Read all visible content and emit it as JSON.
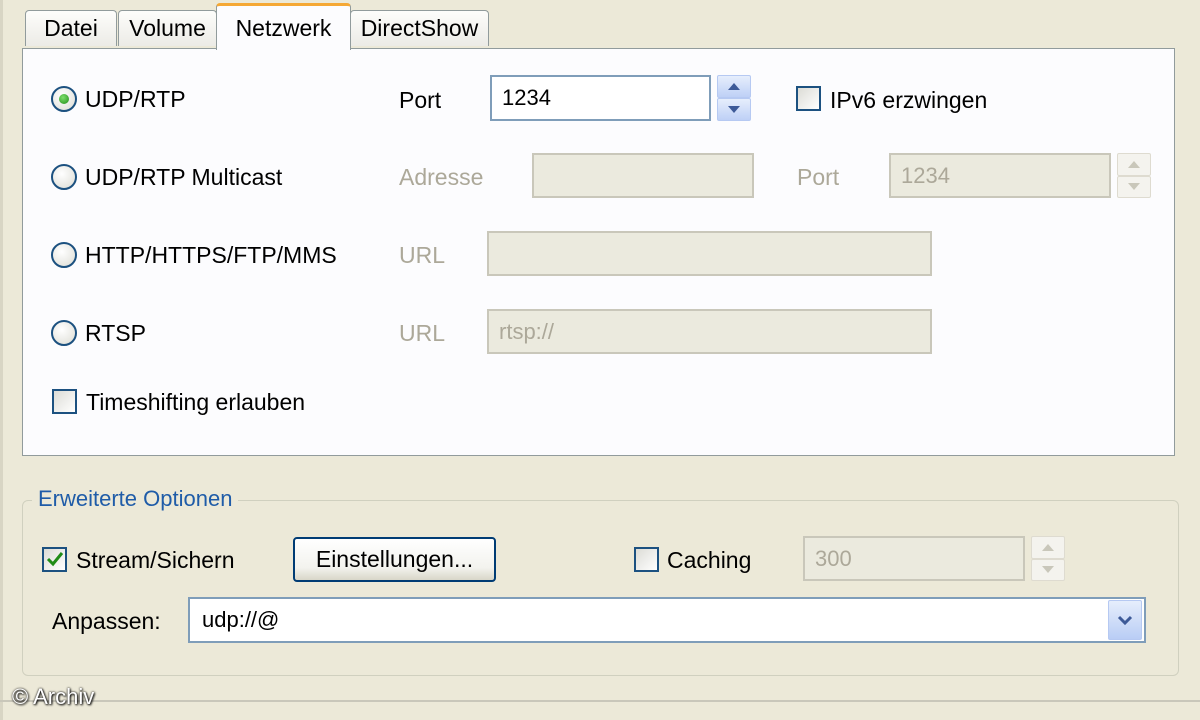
{
  "tabs": [
    {
      "label": "Datei"
    },
    {
      "label": "Volume"
    },
    {
      "label": "Netzwerk"
    },
    {
      "label": "DirectShow"
    }
  ],
  "active_tab": "Netzwerk",
  "network": {
    "udp_rtp": {
      "label": "UDP/RTP",
      "selected": true,
      "port_label": "Port",
      "port_value": "1234",
      "ipv6_label": "IPv6 erzwingen",
      "ipv6_checked": false
    },
    "multicast": {
      "label": "UDP/RTP Multicast",
      "selected": false,
      "address_label": "Adresse",
      "address_value": "",
      "port_label": "Port",
      "port_value": "1234"
    },
    "http": {
      "label": "HTTP/HTTPS/FTP/MMS",
      "selected": false,
      "url_label": "URL",
      "url_value": ""
    },
    "rtsp": {
      "label": "RTSP",
      "selected": false,
      "url_label": "URL",
      "url_value": "rtsp://"
    },
    "timeshift": {
      "label": "Timeshifting erlauben",
      "checked": false
    }
  },
  "advanced": {
    "legend": "Erweiterte Optionen",
    "stream": {
      "label": "Stream/Sichern",
      "checked": true
    },
    "settings_button": "Einstellungen...",
    "caching": {
      "label": "Caching",
      "checked": false,
      "value": "300"
    },
    "customize": {
      "label": "Anpassen:",
      "value": "udp://@"
    }
  },
  "watermark": "© Archiv",
  "colors": {
    "accent": "#1f5ca8",
    "tab_highlight": "#f5a835",
    "check_green": "#1f8c17"
  }
}
